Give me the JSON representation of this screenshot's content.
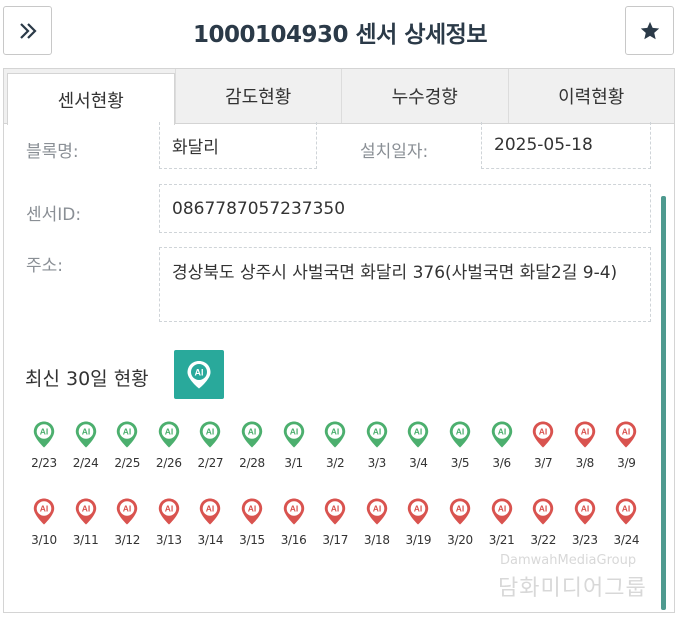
{
  "header": {
    "title": "1000104930 센서 상세정보",
    "expand_icon": "double-chevron-right-icon",
    "star_icon": "star-icon"
  },
  "tabs": [
    {
      "label": "센서현황",
      "active": true
    },
    {
      "label": "감도현황",
      "active": false
    },
    {
      "label": "누수경향",
      "active": false
    },
    {
      "label": "이력현황",
      "active": false
    }
  ],
  "info": {
    "block_label": "블록명:",
    "block_value": "화달리",
    "install_label": "설치일자:",
    "install_value": "2025-05-18",
    "sensor_label": "센서ID:",
    "sensor_value": "0867787057237350",
    "address_label": "주소:",
    "address_value": "경상북도 상주시 사벌국면 화달리 376(사벌국면 화달2길 9-4)"
  },
  "recent": {
    "title": "최신 30일 현황",
    "ai_icon": "ai-pin-icon",
    "colors": {
      "normal": "#4caf6e",
      "leak": "#d9534f",
      "accent": "#29a99b"
    },
    "days": [
      {
        "date": "2/23",
        "status": "normal"
      },
      {
        "date": "2/24",
        "status": "normal"
      },
      {
        "date": "2/25",
        "status": "normal"
      },
      {
        "date": "2/26",
        "status": "normal"
      },
      {
        "date": "2/27",
        "status": "normal"
      },
      {
        "date": "2/28",
        "status": "normal"
      },
      {
        "date": "3/1",
        "status": "normal"
      },
      {
        "date": "3/2",
        "status": "normal"
      },
      {
        "date": "3/3",
        "status": "normal"
      },
      {
        "date": "3/4",
        "status": "normal"
      },
      {
        "date": "3/5",
        "status": "normal"
      },
      {
        "date": "3/6",
        "status": "normal"
      },
      {
        "date": "3/7",
        "status": "leak"
      },
      {
        "date": "3/8",
        "status": "leak"
      },
      {
        "date": "3/9",
        "status": "leak"
      },
      {
        "date": "3/10",
        "status": "leak"
      },
      {
        "date": "3/11",
        "status": "leak"
      },
      {
        "date": "3/12",
        "status": "leak"
      },
      {
        "date": "3/13",
        "status": "leak"
      },
      {
        "date": "3/14",
        "status": "leak"
      },
      {
        "date": "3/15",
        "status": "leak"
      },
      {
        "date": "3/16",
        "status": "leak"
      },
      {
        "date": "3/17",
        "status": "leak"
      },
      {
        "date": "3/18",
        "status": "leak"
      },
      {
        "date": "3/19",
        "status": "leak"
      },
      {
        "date": "3/20",
        "status": "leak"
      },
      {
        "date": "3/21",
        "status": "leak"
      },
      {
        "date": "3/22",
        "status": "leak"
      },
      {
        "date": "3/23",
        "status": "leak"
      },
      {
        "date": "3/24",
        "status": "leak"
      }
    ],
    "pin_text": "AI"
  },
  "watermark": {
    "line1": "DamwahMediaGroup",
    "line2": "담화미디어그룹"
  }
}
